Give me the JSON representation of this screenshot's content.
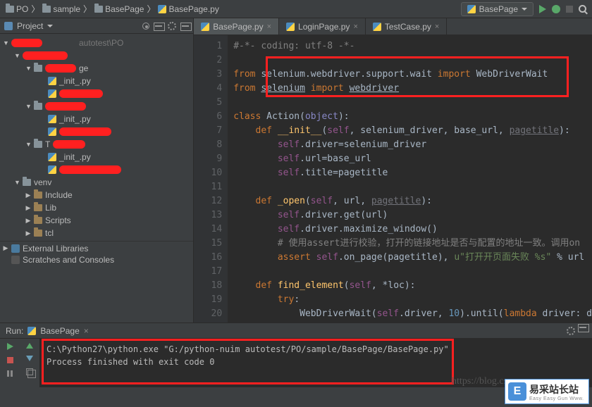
{
  "breadcrumb": [
    {
      "type": "folder",
      "label": "PO"
    },
    {
      "type": "folder",
      "label": "sample"
    },
    {
      "type": "folder",
      "label": "BasePage"
    },
    {
      "type": "py",
      "label": "BasePage.py"
    }
  ],
  "run_config": {
    "label": "BasePage"
  },
  "sidebar": {
    "title": "Project"
  },
  "tree": {
    "root_path": "autotest\\PO",
    "init_py": "_init_.py",
    "basepage_suffix": "ge",
    "t_prefix": "T",
    "venv": "venv",
    "include": "Include",
    "lib": "Lib",
    "scripts": "Scripts",
    "tcl": "tcl",
    "ext_lib": "External Libraries",
    "scratches": "Scratches and Consoles"
  },
  "tabs": [
    {
      "label": "BasePage.py",
      "active": true
    },
    {
      "label": "LoginPage.py",
      "active": false
    },
    {
      "label": "TestCase.py",
      "active": false
    }
  ],
  "code_lines": [
    {
      "n": 1,
      "html": "<span class='com'>#-*- coding: utf-8 -*-</span>"
    },
    {
      "n": 2,
      "html": ""
    },
    {
      "n": 3,
      "html": "<span class='kw'>from</span> selenium.webdriver.support.wait <span class='kw'>import</span> WebDriverWait"
    },
    {
      "n": 4,
      "html": "<span class='kw'>from</span> <span style='text-decoration:underline'>selenium</span> <span class='kw'>import</span> <span style='text-decoration:underline'>webdriver</span>"
    },
    {
      "n": 5,
      "html": ""
    },
    {
      "n": 6,
      "html": "<span class='kw'>class</span> <span class='cls'>Action</span>(<span class='builtin'>object</span>):"
    },
    {
      "n": 7,
      "html": "    <span class='kw'>def</span> <span class='fn'>__init__</span>(<span class='self'>self</span>, selenium_driver, base_url, <span class='param'>pagetitle</span>):"
    },
    {
      "n": 8,
      "html": "        <span class='self'>self</span>.driver=selenium_driver"
    },
    {
      "n": 9,
      "html": "        <span class='self'>self</span>.url=base_url"
    },
    {
      "n": 10,
      "html": "        <span class='self'>self</span>.title=pagetitle"
    },
    {
      "n": 11,
      "html": ""
    },
    {
      "n": 12,
      "html": "    <span class='kw'>def</span> <span class='fn'>_open</span>(<span class='self'>self</span>, url, <span class='param'>pagetitle</span>):"
    },
    {
      "n": 13,
      "html": "        <span class='self'>self</span>.driver.get(url)"
    },
    {
      "n": 14,
      "html": "        <span class='self'>self</span>.driver.maximize_window()"
    },
    {
      "n": 15,
      "html": "        <span class='com'># 使用assert进行校验，打开的链接地址是否与配置的地址一致。调用on</span>"
    },
    {
      "n": 16,
      "html": "        <span class='kw'>assert</span> <span class='self'>self</span>.on_page(pagetitle), <span class='str'>u\"打开开页面失败 %s\"</span> % url"
    },
    {
      "n": 17,
      "html": ""
    },
    {
      "n": 18,
      "html": "    <span class='kw'>def</span> <span class='fn'>find_element</span>(<span class='self'>self</span>, *loc):"
    },
    {
      "n": 19,
      "html": "        <span class='kw'>try</span>:"
    },
    {
      "n": 20,
      "html": "            WebDriverWait(<span class='self'>self</span>.driver, <span class='num'>10</span>).until(<span class='kw'>lambda</span> driver: d"
    }
  ],
  "run_panel": {
    "title": "Run:",
    "tab": "BasePage",
    "line1": "C:\\Python27\\python.exe \"G:/python-nuim autotest/PO/sample/BasePage/BasePage.py\"",
    "line2": "",
    "line3": "Process finished with exit code 0"
  },
  "watermark": "https://blog.cs",
  "logo": {
    "main": "易采站长站",
    "sub": "Easy Easy Gun Www.",
    "letter": "E"
  }
}
